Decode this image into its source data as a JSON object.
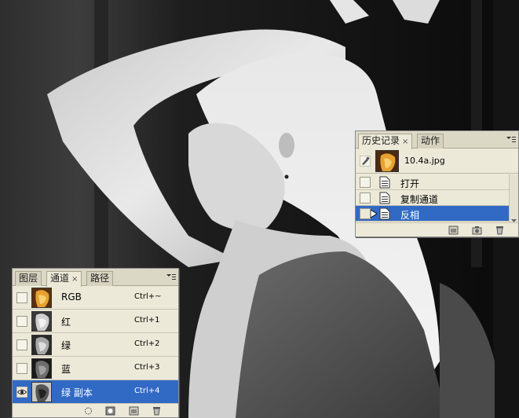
{
  "history_panel": {
    "tabs": [
      {
        "label": "历史记录",
        "close": "×",
        "active": true
      },
      {
        "label": "动作",
        "active": false
      }
    ],
    "snapshot": {
      "name": "10.4a.jpg"
    },
    "steps": [
      {
        "label": "打开",
        "selected": false
      },
      {
        "label": "复制通道",
        "selected": false
      },
      {
        "label": "反相",
        "selected": true
      }
    ],
    "footer_icons": [
      "new-document-icon",
      "camera-snapshot-icon",
      "trash-icon"
    ]
  },
  "channels_panel": {
    "tabs": [
      {
        "label": "图层",
        "active": false
      },
      {
        "label": "通道",
        "close": "×",
        "active": true
      },
      {
        "label": "路径",
        "active": false
      }
    ],
    "rows": [
      {
        "name": "RGB",
        "shortcut": "Ctrl+~",
        "visible": false,
        "selected": false
      },
      {
        "name": "红",
        "shortcut": "Ctrl+1",
        "visible": false,
        "selected": false
      },
      {
        "name": "绿",
        "shortcut": "Ctrl+2",
        "visible": false,
        "selected": false
      },
      {
        "name": "蓝",
        "shortcut": "Ctrl+3",
        "visible": false,
        "selected": false
      },
      {
        "name": "绿 副本",
        "shortcut": "Ctrl+4",
        "visible": true,
        "selected": true
      }
    ],
    "footer_icons": [
      "load-selection-icon",
      "save-selection-icon",
      "new-channel-icon",
      "trash-icon"
    ]
  },
  "colors": {
    "selection": "#316ac5",
    "panel_bg": "#ece9d8"
  }
}
